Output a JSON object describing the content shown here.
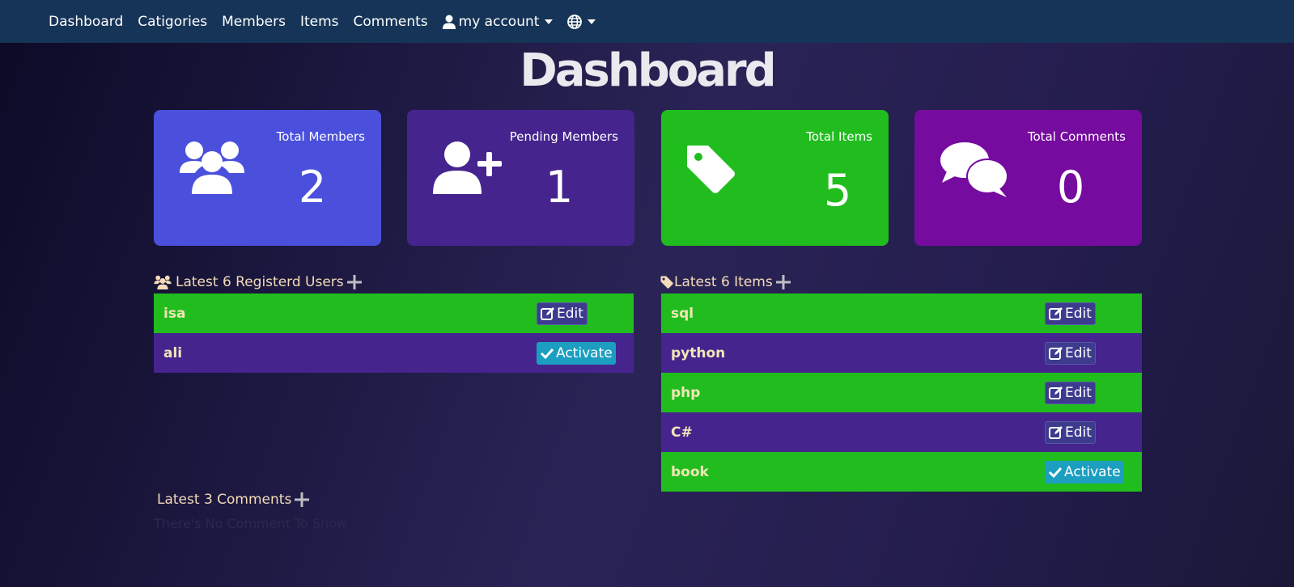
{
  "nav": {
    "items": [
      "Dashboard",
      "Catigories",
      "Members",
      "Items",
      "Comments"
    ],
    "account_label": "my account"
  },
  "page_title": "Dashboard",
  "stats": [
    {
      "label": "Total Members",
      "value": "2",
      "icon": "users-icon",
      "color": "#4a50dc"
    },
    {
      "label": "Pending Members",
      "value": "1",
      "icon": "user-plus-icon",
      "color": "#45248e"
    },
    {
      "label": "Total Items",
      "value": "5",
      "icon": "tag-icon",
      "color": "#21bd1e"
    },
    {
      "label": "Total Comments",
      "value": "0",
      "icon": "comments-icon",
      "color": "#760b9f"
    }
  ],
  "latest_users": {
    "heading": "Latest 6 Registerd Users",
    "rows": [
      {
        "name": "isa",
        "action": "Edit"
      },
      {
        "name": "ali",
        "action": "Activate"
      }
    ]
  },
  "latest_items": {
    "heading": "Latest 6 Items",
    "rows": [
      {
        "name": "sql",
        "action": "Edit"
      },
      {
        "name": "python",
        "action": "Edit"
      },
      {
        "name": "php",
        "action": "Edit"
      },
      {
        "name": "C#",
        "action": "Edit"
      },
      {
        "name": "book",
        "action": "Activate"
      }
    ]
  },
  "latest_comments": {
    "heading": "Latest 3 Comments",
    "empty_text": "There's No Comment To Show"
  }
}
